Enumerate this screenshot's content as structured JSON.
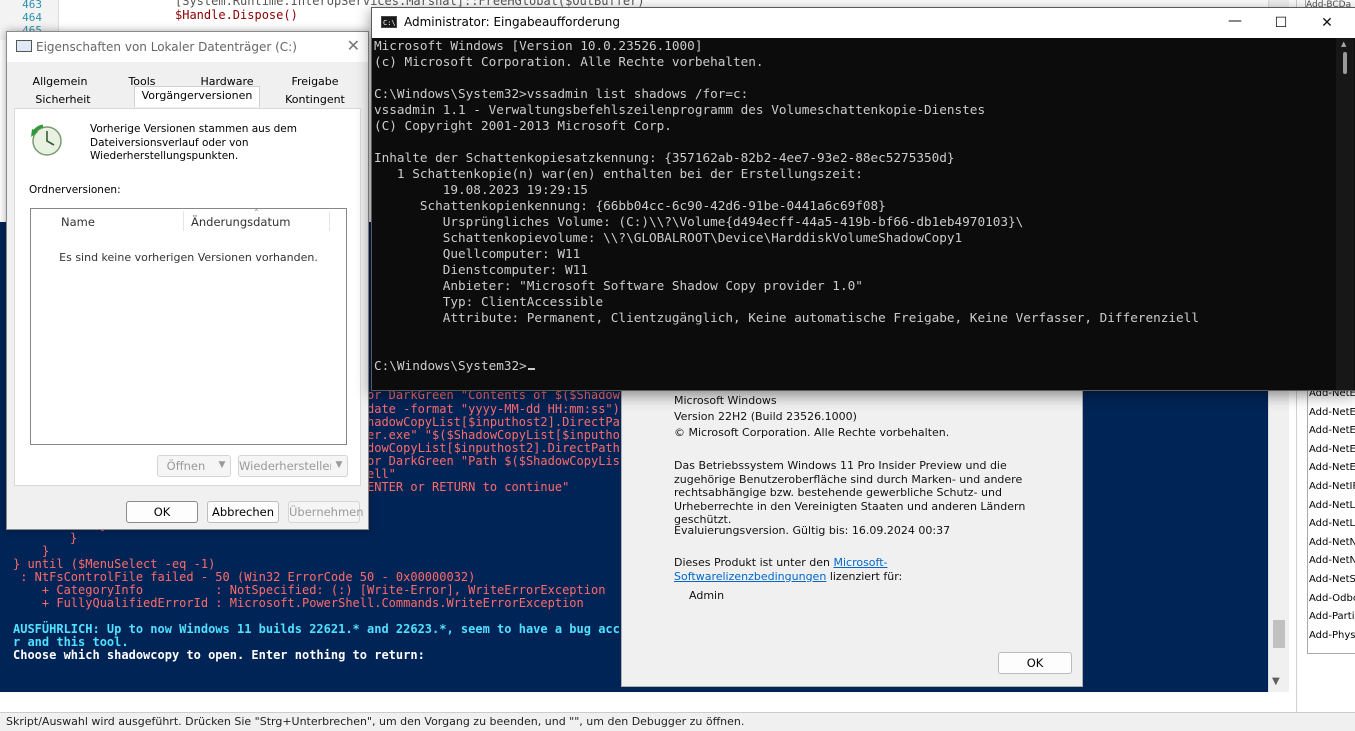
{
  "ise": {
    "editor": {
      "line_numbers": [
        "463",
        "464",
        "465"
      ],
      "code_lines": [
        "[System.Runtime.InteropServices.Marshal]::FreeHGlobal($OutBuffer)",
        "$Handle.Dispose()"
      ]
    },
    "console_lines": [
      "or DarkGreen \"Contents of $($Shadow",
      "date -format \"yyyy-MM-dd HH:mm:ss\")",
      "hadowCopyList[$inputhost2].DirectPa",
      "er.exe\" \"$($ShadowCopyList[$inputho",
      "dowCopyList[$inputhost2].DirectPath",
      "or DarkGreen \"Path $($ShadowCopyLis",
      "ell\"",
      "ENTER or RETURN to continue\""
    ],
    "console_braces": [
      "}",
      "}",
      "}",
      "} until ($MenuSelect -eq -1)"
    ],
    "error_lines": [
      " : NtFsControlFile failed - 50 (Win32 ErrorCode 50 - 0x00000032)",
      "    + CategoryInfo          : NotSpecified: (:) [Write-Error], WriteErrorException",
      "    + FullyQualifiedErrorId : Microsoft.PowerShell.Commands.WriteErrorException"
    ],
    "verbose_lines": [
      "AUSFÜHRLICH: Up to now Windows 11 builds 22621.* and 22623.*, seem to have a bug acc",
      "r and this tool."
    ],
    "prompt_line": "Choose which shadowcopy to open. Enter nothing to return:",
    "status_text": "Skript/Auswahl wird ausgeführt. Drücken Sie \"Strg+Unterbrechen\", um den Vorgang zu beenden, und \"\", um den Debugger zu öffnen."
  },
  "commands_pane": {
    "top_fragment": "Add-BCDa",
    "items": [
      "Add-NetE",
      "Add-NetE",
      "Add-NetE",
      "Add-NetE",
      "Add-NetE",
      "Add-NetIP",
      "Add-NetL",
      "Add-NetL",
      "Add-NetN",
      "Add-NetN",
      "Add-NetS",
      "Add-Odbc",
      "Add-Parti",
      "Add-Phys"
    ]
  },
  "properties_dialog": {
    "title": "Eigenschaften von Lokaler Datenträger (C:)",
    "tabs_row1": [
      "Allgemein",
      "Tools",
      "Hardware",
      "Freigabe"
    ],
    "tabs_row2": [
      "Sicherheit",
      "Vorgängerversionen",
      "Kontingent"
    ],
    "info_text": "Vorherige Versionen stammen aus dem Dateiversionsverlauf oder von Wiederherstellungspunkten.",
    "folder_versions_label": "Ordnerversionen:",
    "columns": [
      "Name",
      "Änderungsdatum"
    ],
    "empty_message": "Es sind keine vorherigen Versionen vorhanden.",
    "open_button": "Öffnen",
    "restore_button": "Wiederherstellen",
    "ok_button": "OK",
    "cancel_button": "Abbrechen",
    "apply_button": "Übernehmen"
  },
  "winver_dialog": {
    "product": "Microsoft Windows",
    "version": "Version 22H2 (Build 23526.1000)",
    "copyright": "© Microsoft Corporation. Alle Rechte vorbehalten.",
    "description": "Das Betriebssystem Windows 11 Pro Insider Preview und die zugehörige Benutzeroberfläche sind durch Marken- und andere rechtsabhängige bzw. bestehende gewerbliche Schutz- und Urheberrechte in den Vereinigten Staaten und anderen Ländern geschützt.",
    "evaluation": "Evaluierungsversion. Gültig bis: 16.09.2024 00:37",
    "license_prefix": "Dieses Produkt ist unter den",
    "license_link": "Microsoft-Softwarelizenzbedingungen",
    "license_suffix": "lizenziert für:",
    "licensed_to": "Admin",
    "ok_button": "OK"
  },
  "cmd_window": {
    "title": "Administrator: Eingabeaufforderung",
    "minimize": "—",
    "maximize": "☐",
    "close": "✕",
    "lines": [
      "Microsoft Windows [Version 10.0.23526.1000]",
      "(c) Microsoft Corporation. Alle Rechte vorbehalten.",
      "",
      "C:\\Windows\\System32>vssadmin list shadows /for=c:",
      "vssadmin 1.1 - Verwaltungsbefehlszeilenprogramm des Volumeschattenkopie-Dienstes",
      "(C) Copyright 2001-2013 Microsoft Corp.",
      "",
      "Inhalte der Schattenkopiesatzkennung: {357162ab-82b2-4ee7-93e2-88ec5275350d}",
      "   1 Schattenkopie(n) war(en) enthalten bei der Erstellungszeit:",
      "         19.08.2023 19:29:15",
      "      Schattenkopienkennung: {66bb04cc-6c90-42d6-91be-0441a6c69f08}",
      "         Ursprüngliches Volume: (C:)\\\\?\\Volume{d494ecff-44a5-419b-bf66-db1eb4970103}\\",
      "         Schattenkopievolume: \\\\?\\GLOBALROOT\\Device\\HarddiskVolumeShadowCopy1",
      "         Quellcomputer: W11",
      "         Dienstcomputer: W11",
      "         Anbieter: \"Microsoft Software Shadow Copy provider 1.0\"",
      "         Typ: ClientAccessible",
      "         Attribute: Permanent, Clientzugänglich, Keine automatische Freigabe, Keine Verfasser, Differenziell",
      "",
      "",
      "C:\\Windows\\System32>"
    ]
  }
}
